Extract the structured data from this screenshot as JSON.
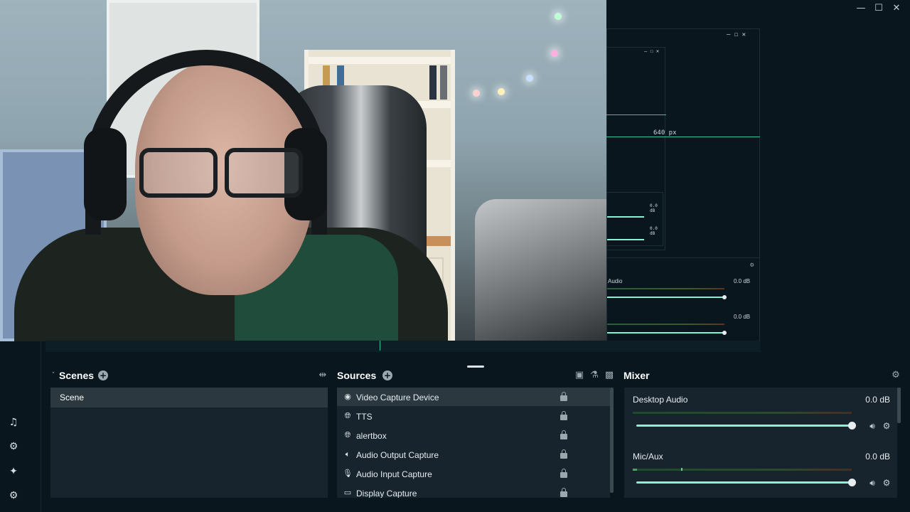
{
  "preview": {
    "resolution_label": "640 px",
    "mini_mixer_db": [
      "0.0 dB",
      "0.0 dB"
    ],
    "side_mixer": [
      {
        "name": "Audio",
        "db": "0.0 dB"
      },
      {
        "name": "",
        "db": "0.0 dB"
      }
    ]
  },
  "scenes": {
    "title": "Scenes",
    "items": [
      "Scene"
    ]
  },
  "sources": {
    "title": "Sources",
    "items": [
      {
        "label": "Video Capture Device",
        "icon": "webcam-icon",
        "selected": true
      },
      {
        "label": "TTS",
        "icon": "globe-icon",
        "selected": false
      },
      {
        "label": "alertbox",
        "icon": "globe-icon",
        "selected": false
      },
      {
        "label": "Audio Output Capture",
        "icon": "speaker-icon",
        "selected": false
      },
      {
        "label": "Audio Input Capture",
        "icon": "microphone-icon",
        "selected": false
      },
      {
        "label": "Display Capture",
        "icon": "monitor-icon",
        "selected": false
      }
    ]
  },
  "mixer": {
    "title": "Mixer",
    "channels": [
      {
        "name": "Desktop Audio",
        "db": "0.0 dB",
        "volume": 1.0,
        "level": 0.0
      },
      {
        "name": "Mic/Aux",
        "db": "0.0 dB",
        "volume": 1.0,
        "level": 0.02
      }
    ]
  },
  "colors": {
    "background": "#09161d",
    "panel": "#17242d",
    "selected": "#2b3840",
    "accent": "#80f5d2"
  }
}
